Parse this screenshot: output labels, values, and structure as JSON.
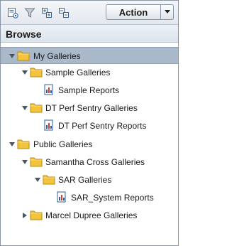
{
  "toolbar": {
    "icons": [
      "properties-icon",
      "filter-icon",
      "expand-all-icon",
      "collapse-all-icon"
    ],
    "action_label": "Action"
  },
  "panel": {
    "title": "Browse"
  },
  "tree": {
    "items": [
      {
        "label": "My Galleries",
        "type": "folder",
        "expanded": true,
        "selected": true,
        "level": 0
      },
      {
        "label": "Sample Galleries",
        "type": "folder",
        "expanded": true,
        "selected": false,
        "level": 1
      },
      {
        "label": "Sample Reports",
        "type": "report",
        "selected": false,
        "level": 2
      },
      {
        "label": "DT Perf Sentry Galleries",
        "type": "folder",
        "expanded": true,
        "selected": false,
        "level": 1
      },
      {
        "label": "DT Perf Sentry Reports",
        "type": "report",
        "selected": false,
        "level": 2
      },
      {
        "label": "Public Galleries",
        "type": "folder",
        "expanded": true,
        "selected": false,
        "level": 0
      },
      {
        "label": "Samantha Cross Galleries",
        "type": "folder",
        "expanded": true,
        "selected": false,
        "level": 1
      },
      {
        "label": "SAR Galleries",
        "type": "folder",
        "expanded": true,
        "selected": false,
        "level": 2
      },
      {
        "label": "SAR_System Reports",
        "type": "report",
        "selected": false,
        "level": 3
      },
      {
        "label": "Marcel Dupree Galleries",
        "type": "folder",
        "expanded": false,
        "selected": false,
        "level": 1
      }
    ]
  },
  "colors": {
    "selection": "#a9b9c9",
    "folder": "#f2c33b",
    "frame_border": "#8a97a8"
  }
}
